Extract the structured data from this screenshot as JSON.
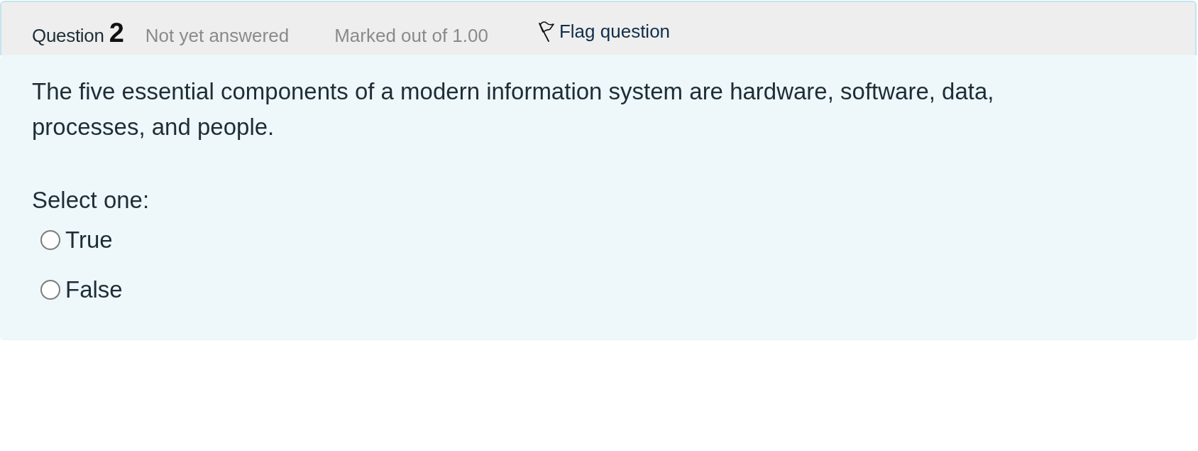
{
  "question": {
    "label": "Question",
    "number": "2",
    "status": "Not yet answered",
    "mark": "Marked out of 1.00",
    "flag": {
      "label": "Flag question",
      "flagged": false
    }
  },
  "content": {
    "text": "The five essential components of a modern information system are hardware, software, data, processes, and people.",
    "prompt": "Select one:",
    "options": [
      {
        "label": "True",
        "selected": false
      },
      {
        "label": "False",
        "selected": false
      }
    ]
  }
}
